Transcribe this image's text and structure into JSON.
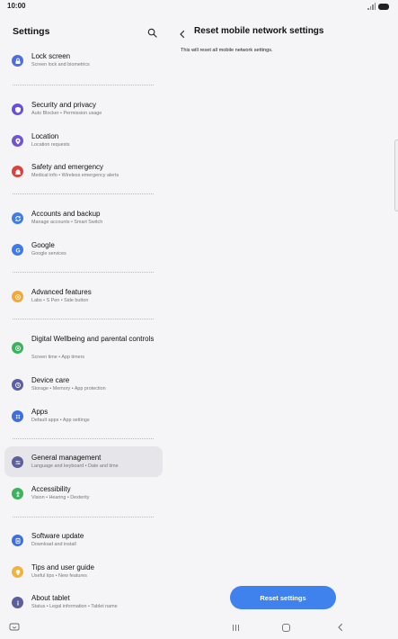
{
  "status_bar": {
    "time": "10:00"
  },
  "left_pane": {
    "title": "Settings",
    "items": [
      {
        "title": "Lock screen",
        "subtitle": "Screen lock and biometrics",
        "icon": "lock-icon",
        "color": "#4c6fe0"
      },
      {
        "title": "Security and privacy",
        "subtitle": "Auto Blocker  •  Permission usage",
        "icon": "shield-icon",
        "color": "#6a4fdc"
      },
      {
        "title": "Location",
        "subtitle": "Location requests",
        "icon": "location-pin-icon",
        "color": "#7153d6"
      },
      {
        "title": "Safety and emergency",
        "subtitle": "Medical info  •  Wireless emergency alerts",
        "icon": "emergency-bell-icon",
        "color": "#d9433b"
      },
      {
        "title": "Accounts and backup",
        "subtitle": "Manage accounts  •  Smart Switch",
        "icon": "sync-icon",
        "color": "#3f7de4"
      },
      {
        "title": "Google",
        "subtitle": "Google services",
        "icon": "google-icon",
        "color": "#3e7bea"
      },
      {
        "title": "Advanced features",
        "subtitle": "Labs  •  S Pen  •  Side button",
        "icon": "advanced-features-icon",
        "color": "#f1a93a"
      },
      {
        "title": "Digital Wellbeing and parental controls",
        "subtitle": "Screen time  •  App timers",
        "icon": "wellbeing-icon",
        "color": "#3bb25c"
      },
      {
        "title": "Device care",
        "subtitle": "Storage  •  Memory  •  App protection",
        "icon": "device-care-icon",
        "color": "#5a5fa8"
      },
      {
        "title": "Apps",
        "subtitle": "Default apps  •  App settings",
        "icon": "apps-grid-icon",
        "color": "#3e6fe0"
      },
      {
        "title": "General management",
        "subtitle": "Language and keyboard  •  Date and time",
        "icon": "sliders-icon",
        "color": "#5c5f9c"
      },
      {
        "title": "Accessibility",
        "subtitle": "Vision  •  Hearing  •  Dexterity",
        "icon": "accessibility-icon",
        "color": "#3bb25c"
      },
      {
        "title": "Software update",
        "subtitle": "Download and install",
        "icon": "software-update-icon",
        "color": "#3e6fe0"
      },
      {
        "title": "Tips and user guide",
        "subtitle": "Useful tips  •  New features",
        "icon": "lightbulb-icon",
        "color": "#f1b33c"
      },
      {
        "title": "About tablet",
        "subtitle": "Status  •  Legal information  •  Tablet name",
        "icon": "info-icon",
        "color": "#5c5f9c"
      }
    ]
  },
  "detail": {
    "title": "Reset mobile network settings",
    "description": "This will reset all mobile network settings.",
    "reset_button_label": "Reset settings"
  }
}
